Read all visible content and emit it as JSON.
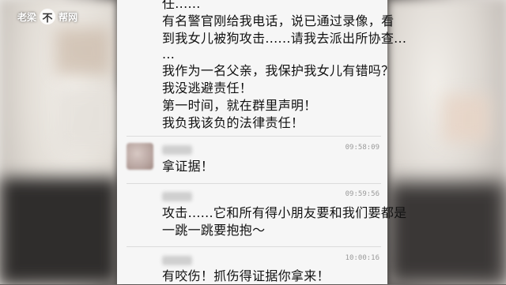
{
  "watermark": {
    "left_text": "老梁",
    "circle_char": "不",
    "right_text": "帮网"
  },
  "chat": {
    "messages": [
      {
        "lines": [
          "任......",
          "有名警官刚给我电话，说已通过录像，看",
          "到我女儿被狗攻击......请我去派出所协查...",
          "...",
          "我作为一名父亲，我保护我女儿有错吗？",
          "我没逃避责任！",
          "第一时间，就在群里声明！",
          "我负我该负的法律责任！"
        ]
      },
      {
        "time": "09:58:09",
        "lines": [
          "拿证据！"
        ]
      },
      {
        "time": "09:59:56",
        "lines": [
          "攻击......它和所有得小朋友要和我们要都是",
          "一跳一跳要抱抱～"
        ]
      },
      {
        "time": "10:00:16",
        "lines": [
          "有咬伤！抓伤得证据你拿来！"
        ]
      }
    ]
  }
}
